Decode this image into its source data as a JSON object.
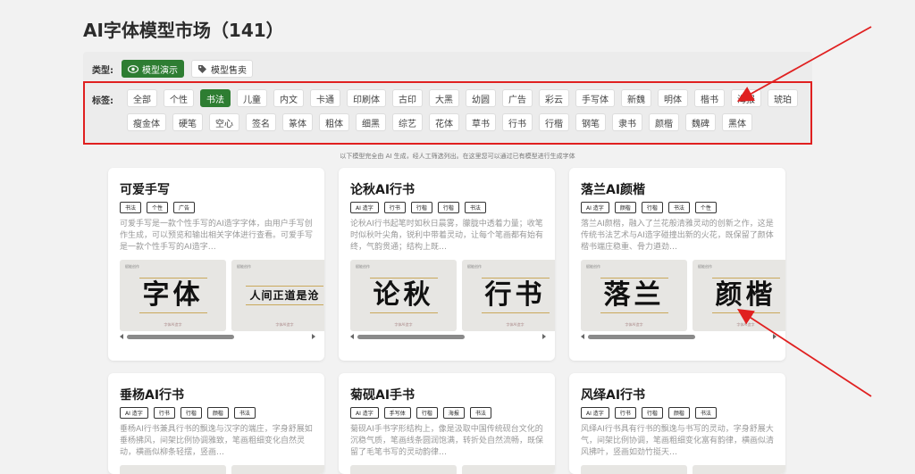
{
  "page": {
    "title": "AI字体模型市场（141）"
  },
  "filters": {
    "type_label": "类型:",
    "types": [
      {
        "label": "模型演示",
        "icon": "eye-icon",
        "active": true
      },
      {
        "label": "模型售卖",
        "icon": "tag-icon",
        "active": false
      }
    ],
    "tag_label": "标签:",
    "tags": [
      "全部",
      "个性",
      "书法",
      "儿童",
      "内文",
      "卡通",
      "印刷体",
      "古印",
      "大黑",
      "幼圆",
      "广告",
      "彩云",
      "手写体",
      "新魏",
      "明体",
      "楷书",
      "海报",
      "琥珀",
      "瘦金体",
      "硬笔",
      "空心",
      "签名",
      "篆体",
      "粗体",
      "细黑",
      "综艺",
      "花体",
      "草书",
      "行书",
      "行楷",
      "钢笔",
      "隶书",
      "颜楷",
      "魏碑",
      "黑体"
    ],
    "active_tag": "书法"
  },
  "notice": "以下模型完全由 AI 生成，经人工筛选列出。在这里您可以通过已有模型进行生成字体",
  "cards": [
    {
      "title": "可爱手写",
      "tags": [
        "书法",
        "个性",
        "广告"
      ],
      "desc": "可爱手写是一款个性手写的AI造字字体，由用户手写创作生成，可以预览和输出相关字体进行查看。可爱手写是一款个性手写的AI造字…",
      "samples": [
        "字体",
        "人间正道是沧"
      ]
    },
    {
      "title": "论秋AI行书",
      "tags": [
        "AI 造字",
        "行书",
        "行楷",
        "行楷",
        "书法"
      ],
      "desc": "论秋AI行书起笔时如秋日晨雾，朦胧中透着力量；收笔时似秋叶尖角，锐利中带着灵动，让每个笔画都有始有终，气韵贯通；结构上既…",
      "samples": [
        "论秋",
        "行书"
      ]
    },
    {
      "title": "落兰AI颜楷",
      "tags": [
        "AI 造字",
        "颜楷",
        "行楷",
        "书法",
        "个性"
      ],
      "desc": "落兰AI颜楷，融入了兰花般清雅灵动的创新之作，这是传统书法艺术与AI造字碰撞出新的火花，既保留了颜体楷书端庄稳重、骨力遒劲…",
      "samples": [
        "落兰",
        "颜楷"
      ]
    },
    {
      "title": "垂杨AI行书",
      "tags": [
        "AI 造字",
        "行书",
        "行楷",
        "颜楷",
        "书法"
      ],
      "desc": "垂杨AI行书兼具行书的飘逸与汉字的端庄，字身舒展如垂杨拂风，间架比例协调雅致，笔画粗细变化自然灵动，横画似柳条轻摆，竖画…",
      "samples": []
    },
    {
      "title": "菊砚AI手书",
      "tags": [
        "AI 造字",
        "手写体",
        "行楷",
        "海报",
        "书法"
      ],
      "desc": "菊砚AI手书字形结构上，像是汲取中国传统砚台文化的沉稳气质，笔画线条圆润饱满，转折处自然流畅，既保留了毛笔书写的灵动韵律…",
      "samples": []
    },
    {
      "title": "风绎AI行书",
      "tags": [
        "AI 造字",
        "行书",
        "行楷",
        "颜楷",
        "书法"
      ],
      "desc": "风绎AI行书具有行书的飘逸与书写的灵动，字身舒展大气，间架比例协调，笔画粗细变化富有韵律，横画似清风拂叶，竖画如劲竹挺天…",
      "samples": []
    }
  ],
  "thumb_caption": "赋能创作",
  "thumb_footer": "字体AI造字",
  "colors": {
    "accent": "#2e7d32",
    "annotation": "#e02020"
  }
}
